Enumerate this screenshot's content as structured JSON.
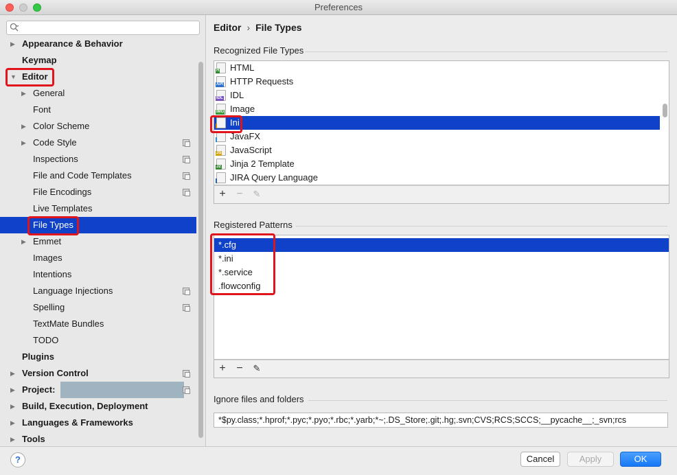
{
  "window": {
    "title": "Preferences"
  },
  "sidebar": {
    "search_placeholder": "",
    "items": [
      {
        "label": "Appearance & Behavior",
        "level": 0,
        "bold": true,
        "arrow": "right",
        "copy": false
      },
      {
        "label": "Keymap",
        "level": 0,
        "bold": true,
        "arrow": "",
        "copy": false
      },
      {
        "label": "Editor",
        "level": 0,
        "bold": true,
        "arrow": "down",
        "copy": false
      },
      {
        "label": "General",
        "level": 1,
        "bold": false,
        "arrow": "right",
        "copy": false
      },
      {
        "label": "Font",
        "level": 1,
        "bold": false,
        "arrow": "",
        "copy": false
      },
      {
        "label": "Color Scheme",
        "level": 1,
        "bold": false,
        "arrow": "right",
        "copy": false
      },
      {
        "label": "Code Style",
        "level": 1,
        "bold": false,
        "arrow": "right",
        "copy": true
      },
      {
        "label": "Inspections",
        "level": 1,
        "bold": false,
        "arrow": "",
        "copy": true
      },
      {
        "label": "File and Code Templates",
        "level": 1,
        "bold": false,
        "arrow": "",
        "copy": true
      },
      {
        "label": "File Encodings",
        "level": 1,
        "bold": false,
        "arrow": "",
        "copy": true
      },
      {
        "label": "Live Templates",
        "level": 1,
        "bold": false,
        "arrow": "",
        "copy": false
      },
      {
        "label": "File Types",
        "level": 1,
        "bold": false,
        "arrow": "",
        "copy": false,
        "selected": true
      },
      {
        "label": "Emmet",
        "level": 1,
        "bold": false,
        "arrow": "right",
        "copy": false
      },
      {
        "label": "Images",
        "level": 1,
        "bold": false,
        "arrow": "",
        "copy": false
      },
      {
        "label": "Intentions",
        "level": 1,
        "bold": false,
        "arrow": "",
        "copy": false
      },
      {
        "label": "Language Injections",
        "level": 1,
        "bold": false,
        "arrow": "",
        "copy": true
      },
      {
        "label": "Spelling",
        "level": 1,
        "bold": false,
        "arrow": "",
        "copy": true
      },
      {
        "label": "TextMate Bundles",
        "level": 1,
        "bold": false,
        "arrow": "",
        "copy": false
      },
      {
        "label": "TODO",
        "level": 1,
        "bold": false,
        "arrow": "",
        "copy": false
      },
      {
        "label": "Plugins",
        "level": 0,
        "bold": true,
        "arrow": "",
        "copy": false
      },
      {
        "label": "Version Control",
        "level": 0,
        "bold": true,
        "arrow": "right",
        "copy": true
      },
      {
        "label": "Project:",
        "level": 0,
        "bold": true,
        "arrow": "right",
        "copy": true,
        "redacted": true
      },
      {
        "label": "Build, Execution, Deployment",
        "level": 0,
        "bold": true,
        "arrow": "right",
        "copy": false
      },
      {
        "label": "Languages & Frameworks",
        "level": 0,
        "bold": true,
        "arrow": "right",
        "copy": false
      },
      {
        "label": "Tools",
        "level": 0,
        "bold": true,
        "arrow": "right",
        "copy": false
      }
    ]
  },
  "breadcrumb": {
    "parent": "Editor",
    "separator": "›",
    "current": "File Types"
  },
  "recognized": {
    "title": "Recognized File Types",
    "items": [
      {
        "label": "HTML",
        "icon": "html-file-icon",
        "tag": "H",
        "tag_color": "#2e8b2e"
      },
      {
        "label": "HTTP Requests",
        "icon": "api-file-icon",
        "tag": "API",
        "tag_color": "#2d6fd3"
      },
      {
        "label": "IDL",
        "icon": "idl-file-icon",
        "tag": "IDL",
        "tag_color": "#7b52c4"
      },
      {
        "label": "Image",
        "icon": "image-file-icon",
        "tag": "IMG",
        "tag_color": "#3a9a3a"
      },
      {
        "label": "Ini",
        "icon": "ini-file-icon",
        "tag": "",
        "tag_color": "#c98b15",
        "selected": true
      },
      {
        "label": "JavaFX",
        "icon": "javafx-file-icon",
        "tag": "",
        "tag_color": "#2d8ad3"
      },
      {
        "label": "JavaScript",
        "icon": "js-file-icon",
        "tag": "JS",
        "tag_color": "#d4a516"
      },
      {
        "label": "Jinja 2 Template",
        "icon": "jinja-file-icon",
        "tag": "J2",
        "tag_color": "#3a8a3a"
      },
      {
        "label": "JIRA Query Language",
        "icon": "jira-icon",
        "tag": "",
        "tag_color": "#2d5fa8"
      }
    ],
    "toolbar": {
      "add": "+",
      "remove": "−",
      "edit": "✎"
    }
  },
  "patterns": {
    "title": "Registered Patterns",
    "items": [
      "*.cfg",
      "*.ini",
      "*.service",
      ".flowconfig"
    ],
    "toolbar": {
      "add": "+",
      "remove": "−",
      "edit": "✎"
    }
  },
  "ignore": {
    "title": "Ignore files and folders",
    "value": "*$py.class;*.hprof;*.pyc;*.pyo;*.rbc;*.yarb;*~;.DS_Store;.git;.hg;.svn;CVS;RCS;SCCS;__pycache__;_svn;rcs"
  },
  "footer": {
    "help": "?",
    "cancel": "Cancel",
    "apply": "Apply",
    "ok": "OK"
  },
  "colors": {
    "selection": "#0f42c8",
    "highlight": "#e0141c",
    "ok": "#1678f5"
  }
}
